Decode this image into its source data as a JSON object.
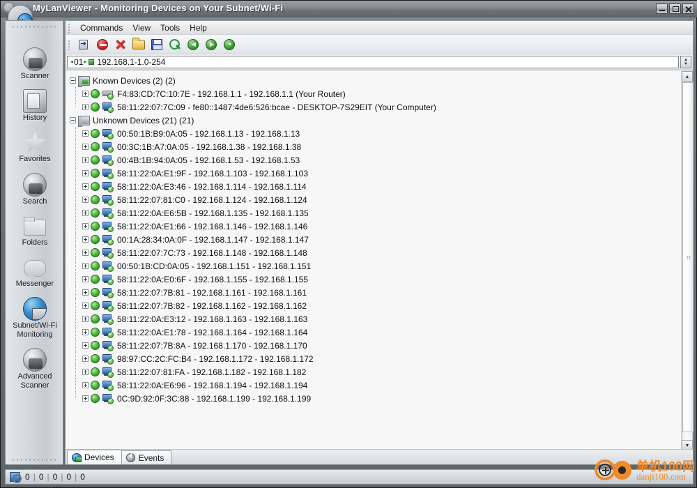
{
  "window": {
    "title": "MyLanViewer - Monitoring Devices on Your Subnet/Wi-Fi",
    "app_icon": "globe-monitor-icon",
    "controls": {
      "minimize": "minimize-button",
      "maximize": "maximize-button",
      "close": "close-button"
    }
  },
  "menubar": {
    "items": [
      {
        "label": "Commands"
      },
      {
        "label": "View"
      },
      {
        "label": "Tools"
      },
      {
        "label": "Help"
      }
    ]
  },
  "toolbar": {
    "buttons": [
      {
        "name": "import-icon",
        "title": "Import"
      },
      {
        "name": "stop-icon",
        "title": "Stop"
      },
      {
        "name": "delete-icon",
        "title": "Delete"
      },
      {
        "name": "open-folder-icon",
        "title": "Open"
      },
      {
        "name": "save-icon",
        "title": "Save"
      },
      {
        "name": "search-icon",
        "title": "Search"
      },
      {
        "name": "back-icon",
        "title": "Back"
      },
      {
        "name": "forward-icon",
        "title": "Forward"
      },
      {
        "name": "refresh-icon",
        "title": "Refresh"
      }
    ]
  },
  "addressbar": {
    "index": "01",
    "range": "192.168.1-1.0-254",
    "left_arrow": "◂",
    "right_arrow": "▸",
    "spin_up": "▲",
    "spin_down": "▼"
  },
  "sidebar": {
    "items": [
      {
        "label": "Scanner",
        "icon": "scanner-globe-icon"
      },
      {
        "label": "History",
        "icon": "history-icon"
      },
      {
        "label": "Favorites",
        "icon": "star-icon"
      },
      {
        "label": "Search",
        "icon": "search-globe-icon"
      },
      {
        "label": "Folders",
        "icon": "folders-icon"
      },
      {
        "label": "Messenger",
        "icon": "messenger-bubble-icon"
      },
      {
        "label": "Subnet/Wi-Fi\nMonitoring",
        "icon": "subnet-monitor-icon"
      },
      {
        "label": "Advanced\nScanner",
        "icon": "advanced-scanner-icon"
      }
    ]
  },
  "tree": {
    "groups": [
      {
        "label": "Known Devices (2) (2)",
        "icon": "known-devices-icon",
        "expanded": true,
        "devices": [
          {
            "text": "F4:83:CD:7C:10:7E - 192.168.1.1 - 192.168.1.1 (Your Router)",
            "icon": "router-icon",
            "status": "online"
          },
          {
            "text": "58:11:22:07:7C:09 - fe80::1487:4de6:526:bcae - DESKTOP-7S29EIT (Your Computer)",
            "icon": "computer-icon",
            "status": "online"
          }
        ]
      },
      {
        "label": "Unknown Devices (21) (21)",
        "icon": "unknown-devices-icon",
        "expanded": true,
        "devices": [
          {
            "text": "00:50:1B:B9:0A:05 - 192.168.1.13 - 192.168.1.13",
            "icon": "computer-icon",
            "status": "online"
          },
          {
            "text": "00:3C:1B:A7:0A:05 - 192.168.1.38 - 192.168.1.38",
            "icon": "computer-icon",
            "status": "online"
          },
          {
            "text": "00:4B:1B:94:0A:05 - 192.168.1.53 - 192.168.1.53",
            "icon": "computer-icon",
            "status": "online"
          },
          {
            "text": "58:11:22:0A:E1:9F - 192.168.1.103 - 192.168.1.103",
            "icon": "computer-icon",
            "status": "online"
          },
          {
            "text": "58:11:22:0A:E3:46 - 192.168.1.114 - 192.168.1.114",
            "icon": "computer-icon",
            "status": "online"
          },
          {
            "text": "58:11:22:07:81:C0 - 192.168.1.124 - 192.168.1.124",
            "icon": "computer-icon",
            "status": "online"
          },
          {
            "text": "58:11:22:0A:E6:5B - 192.168.1.135 - 192.168.1.135",
            "icon": "computer-icon",
            "status": "online"
          },
          {
            "text": "58:11:22:0A:E1:66 - 192.168.1.146 - 192.168.1.146",
            "icon": "computer-icon",
            "status": "online"
          },
          {
            "text": "00:1A:28:34:0A:0F - 192.168.1.147 - 192.168.1.147",
            "icon": "computer-icon",
            "status": "online"
          },
          {
            "text": "58:11:22:07:7C:73 - 192.168.1.148 - 192.168.1.148",
            "icon": "computer-icon",
            "status": "online"
          },
          {
            "text": "00:50:1B:CD:0A:05 - 192.168.1.151 - 192.168.1.151",
            "icon": "computer-icon",
            "status": "online"
          },
          {
            "text": "58:11:22:0A:E0:6F - 192.168.1.155 - 192.168.1.155",
            "icon": "computer-icon",
            "status": "online"
          },
          {
            "text": "58:11:22:07:7B:81 - 192.168.1.161 - 192.168.1.161",
            "icon": "computer-icon",
            "status": "online"
          },
          {
            "text": "58:11:22:07:7B:82 - 192.168.1.162 - 192.168.1.162",
            "icon": "computer-icon",
            "status": "online"
          },
          {
            "text": "58:11:22:0A:E3:12 - 192.168.1.163 - 192.168.1.163",
            "icon": "computer-icon",
            "status": "online"
          },
          {
            "text": "58:11:22:0A:E1:78 - 192.168.1.164 - 192.168.1.164",
            "icon": "computer-icon",
            "status": "online"
          },
          {
            "text": "58:11:22:07:7B:8A - 192.168.1.170 - 192.168.1.170",
            "icon": "computer-icon",
            "status": "online"
          },
          {
            "text": "98:97:CC:2C:FC:B4 - 192.168.1.172 - 192.168.1.172",
            "icon": "computer-icon",
            "status": "online"
          },
          {
            "text": "58:11:22:07:81:FA - 192.168.1.182 - 192.168.1.182",
            "icon": "computer-icon",
            "status": "online"
          },
          {
            "text": "58:11:22:0A:E6:96 - 192.168.1.194 - 192.168.1.194",
            "icon": "computer-icon",
            "status": "online"
          },
          {
            "text": "0C:9D:92:0F:3C:88 - 192.168.1.199 - 192.168.1.199",
            "icon": "computer-icon",
            "status": "online"
          }
        ]
      }
    ]
  },
  "tabs": [
    {
      "label": "Devices",
      "icon": "devices-icon",
      "active": true
    },
    {
      "label": "Events",
      "icon": "events-icon",
      "active": false
    }
  ],
  "statusbar": {
    "icon": "scan-status-icon",
    "counters": [
      "0",
      "0",
      "0",
      "0",
      "0"
    ],
    "separator": "|"
  },
  "watermark": {
    "cn_text": "单机100网",
    "url_text": "danji100.com",
    "color": "#f08a2a"
  },
  "colors": {
    "title_bar": "#7b8287",
    "accent_green": "#2e8b3f",
    "panel_bg": "#f7f7f7",
    "sidebar_bg": "#d3d8dc"
  }
}
